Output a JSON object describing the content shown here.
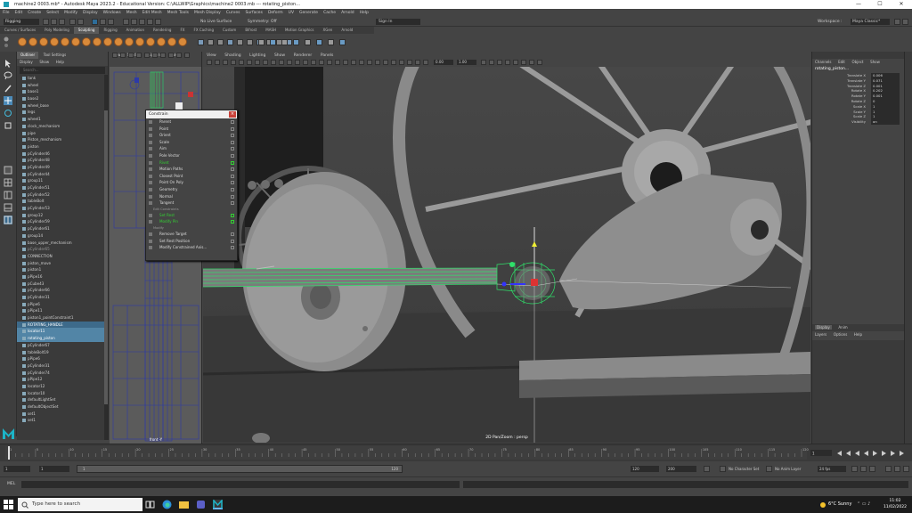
{
  "window": {
    "title": "machine2 0003.mb* - Autodesk Maya 2023.2 - Educational Version: C:\\ALLWIP\\Graphics\\machine2 0003.mb --- rotating_piston...",
    "controls": [
      "—",
      "☐",
      "✕"
    ]
  },
  "menubar": [
    "File",
    "Edit",
    "Create",
    "Select",
    "Modify",
    "Display",
    "Windows",
    "Mesh",
    "Edit Mesh",
    "Mesh Tools",
    "Mesh Display",
    "Curves",
    "Surfaces",
    "Deform",
    "UV",
    "Generate",
    "Cache",
    "Arnold",
    "Help"
  ],
  "statusline": {
    "mode": "Rigging",
    "no_live": "No Live Surface",
    "symmetry": "Symmetry: Off",
    "signin": "Sign In",
    "workspace_label": "Workspace :",
    "workspace": "Maya Classic*"
  },
  "shelf_tabs": [
    {
      "label": "Curves / Surfaces",
      "active": false
    },
    {
      "label": "Poly Modeling",
      "active": false
    },
    {
      "label": "Sculpting",
      "active": true
    },
    {
      "label": "Rigging",
      "active": false
    },
    {
      "label": "Animation",
      "active": false
    },
    {
      "label": "Rendering",
      "active": false
    },
    {
      "label": "FX",
      "active": false
    },
    {
      "label": "FX Caching",
      "active": false
    },
    {
      "label": "Custom",
      "active": false
    },
    {
      "label": "Bifrost",
      "active": false
    },
    {
      "label": "MASH",
      "active": false
    },
    {
      "label": "Motion Graphics",
      "active": false
    },
    {
      "label": "XGen",
      "active": false
    },
    {
      "label": "Arnold",
      "active": false
    }
  ],
  "outliner": {
    "tabs": [
      "Outliner",
      "Tool Settings"
    ],
    "menu": [
      "Display",
      "Show",
      "Help"
    ],
    "search_placeholder": "Search...",
    "items": [
      {
        "label": "tank",
        "state": ""
      },
      {
        "label": "wheel",
        "state": ""
      },
      {
        "label": "base1",
        "state": ""
      },
      {
        "label": "base2",
        "state": ""
      },
      {
        "label": "wheel_base",
        "state": ""
      },
      {
        "label": "legs",
        "state": ""
      },
      {
        "label": "wheel1",
        "state": ""
      },
      {
        "label": "clock_mechanism",
        "state": ""
      },
      {
        "label": "pipe",
        "state": ""
      },
      {
        "label": "Piston_mechanism",
        "state": ""
      },
      {
        "label": "piston",
        "state": ""
      },
      {
        "label": "pCylinder46",
        "state": ""
      },
      {
        "label": "pCylinder48",
        "state": ""
      },
      {
        "label": "pCylinder49",
        "state": ""
      },
      {
        "label": "pCylinder44",
        "state": ""
      },
      {
        "label": "group11",
        "state": ""
      },
      {
        "label": "pCylinder51",
        "state": ""
      },
      {
        "label": "pCylinder52",
        "state": ""
      },
      {
        "label": "tableBolt",
        "state": ""
      },
      {
        "label": "pCylinder53",
        "state": ""
      },
      {
        "label": "group12",
        "state": ""
      },
      {
        "label": "pCylinder59",
        "state": ""
      },
      {
        "label": "pCylinder61",
        "state": ""
      },
      {
        "label": "group14",
        "state": ""
      },
      {
        "label": "base_upper_mechanism",
        "state": ""
      },
      {
        "label": "pCylinder65",
        "state": "fade"
      },
      {
        "label": "CONNECTION",
        "state": ""
      },
      {
        "label": "piston_move",
        "state": ""
      },
      {
        "label": "piston1",
        "state": ""
      },
      {
        "label": "pPipe16",
        "state": ""
      },
      {
        "label": "pCube43",
        "state": ""
      },
      {
        "label": "pCylinder66",
        "state": ""
      },
      {
        "label": "pCylinder31",
        "state": ""
      },
      {
        "label": "pPipe6",
        "state": ""
      },
      {
        "label": "pPipe11",
        "state": ""
      },
      {
        "label": "piston1_pointConstraint1",
        "state": ""
      },
      {
        "label": "ROTATING_HANDLE",
        "state": "sel2"
      },
      {
        "label": "locator11",
        "state": "sel"
      },
      {
        "label": "rotating_piston",
        "state": "sel"
      },
      {
        "label": "pCylinder67",
        "state": ""
      },
      {
        "label": "tableBolt19",
        "state": ""
      },
      {
        "label": "pPipe6",
        "state": ""
      },
      {
        "label": "pCylinder31",
        "state": ""
      },
      {
        "label": "pCylinder74",
        "state": ""
      },
      {
        "label": "pPipe12",
        "state": ""
      },
      {
        "label": "locator12",
        "state": ""
      },
      {
        "label": "locator10",
        "state": ""
      },
      {
        "label": "defaultLightSet",
        "state": ""
      },
      {
        "label": "defaultObjectSet",
        "state": ""
      },
      {
        "label": "set1",
        "state": ""
      },
      {
        "label": "set1",
        "state": ""
      }
    ]
  },
  "viewport_small": {
    "menu": [
      "View",
      "Shading",
      "Lighting",
      "Show"
    ],
    "label": "front -Y"
  },
  "viewport_main": {
    "menu": [
      "View",
      "Shading",
      "Lighting",
      "Show",
      "Renderer",
      "Panels"
    ],
    "label": "2D Pan/Zoom : persp",
    "field1": "0.00",
    "field2": "1.00"
  },
  "constrain_menu": {
    "title": "Constrain",
    "items": [
      {
        "label": "Parent",
        "kind": "item",
        "highlight": false
      },
      {
        "label": "Point",
        "kind": "item",
        "highlight": false
      },
      {
        "label": "Orient",
        "kind": "item",
        "highlight": false
      },
      {
        "label": "Scale",
        "kind": "item",
        "highlight": false
      },
      {
        "label": "Aim",
        "kind": "item",
        "highlight": false
      },
      {
        "label": "Pole Vector",
        "kind": "item",
        "highlight": false
      },
      {
        "label": "Rivet",
        "kind": "item",
        "highlight": true
      },
      {
        "label": "Motion Paths",
        "kind": "item",
        "highlight": false
      },
      {
        "label": "Closest Point",
        "kind": "item",
        "highlight": false
      },
      {
        "label": "Point On Poly",
        "kind": "item",
        "highlight": false
      },
      {
        "label": "Geometry",
        "kind": "item",
        "highlight": false
      },
      {
        "label": "Normal",
        "kind": "item",
        "highlight": false
      },
      {
        "label": "Tangent",
        "kind": "item",
        "highlight": false
      },
      {
        "label": "Edit Constraints",
        "kind": "section",
        "highlight": false
      },
      {
        "label": "Set Rest",
        "kind": "item",
        "highlight": true
      },
      {
        "label": "Modify Pin",
        "kind": "item",
        "highlight": true
      },
      {
        "label": "Modify",
        "kind": "section",
        "highlight": false
      },
      {
        "label": "Remove Target",
        "kind": "item",
        "highlight": false
      },
      {
        "label": "Set Rest Position",
        "kind": "item",
        "highlight": false
      },
      {
        "label": "Modify Constrained Axis...",
        "kind": "item",
        "highlight": false
      }
    ]
  },
  "channel_box": {
    "tabs": [
      "Channels",
      "Edit",
      "Object",
      "Show"
    ],
    "object": "rotating_piston...",
    "attrs": [
      {
        "name": "Translate X",
        "value": "0.006"
      },
      {
        "name": "Translate Y",
        "value": "0.071"
      },
      {
        "name": "Translate Z",
        "value": "0.001"
      },
      {
        "name": "Rotate X",
        "value": "0.202"
      },
      {
        "name": "Rotate Y",
        "value": "0.001"
      },
      {
        "name": "Rotate Z",
        "value": "0"
      },
      {
        "name": "Scale X",
        "value": "1"
      },
      {
        "name": "Scale Y",
        "value": "1"
      },
      {
        "name": "Scale Z",
        "value": "1"
      },
      {
        "name": "Visibility",
        "value": "on"
      }
    ],
    "layer_tabs": [
      "Display",
      "Anim"
    ],
    "layer_menu": [
      "Layers",
      "Options",
      "Help"
    ]
  },
  "timeslider": {
    "current": "1",
    "ticks": [
      "1",
      "5",
      "10",
      "15",
      "20",
      "25",
      "30",
      "35",
      "40",
      "45",
      "50",
      "55",
      "60",
      "65",
      "70",
      "75",
      "80",
      "85",
      "90",
      "95",
      "100",
      "105",
      "110",
      "115",
      "120"
    ]
  },
  "rangebar": {
    "start": "1",
    "start2": "1",
    "range_start": "1",
    "range_end": "120",
    "end": "120",
    "end2": "200",
    "character_set": "No Character Set",
    "anim_layer": "No Anim Layer",
    "fps": "24 fps"
  },
  "cmdline": {
    "label": "MEL"
  },
  "taskbar": {
    "search": "Type here to search",
    "weather": "6°C  Sunny",
    "time": "11:02",
    "date": "11/02/2022"
  }
}
